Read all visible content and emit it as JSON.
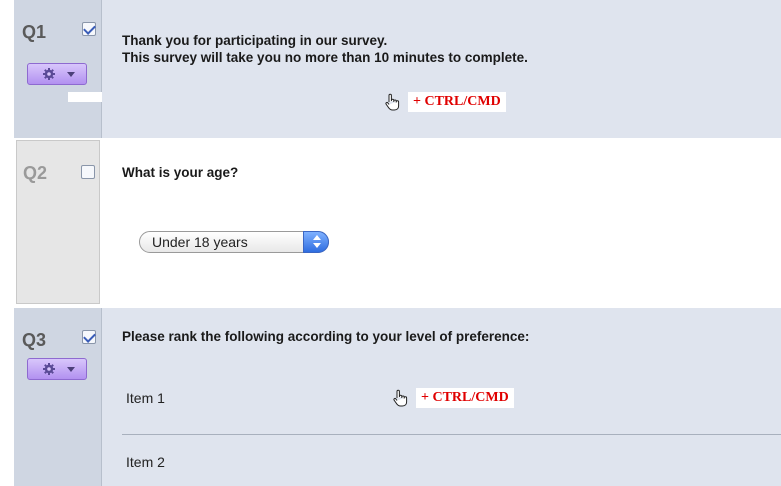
{
  "questions": [
    {
      "number": "Q1",
      "checked": true,
      "lines": [
        "Thank you for participating in our survey.",
        "This survey will take you no more than 10 minutes to complete."
      ],
      "hint": "+ CTRL/CMD"
    },
    {
      "number": "Q2",
      "checked": false,
      "text": "What is your age?",
      "select_value": "Under 18 years"
    },
    {
      "number": "Q3",
      "checked": true,
      "text": "Please rank the following according to your level of preference:",
      "items": [
        "Item 1",
        "Item 2"
      ],
      "hint": "+ CTRL/CMD"
    }
  ],
  "icons": {
    "gear": "gear-icon",
    "dropdown": "chevron-down-icon",
    "hand": "hand-pointer-icon"
  },
  "colors": {
    "selected_bg": "#dfe4ee",
    "gutter_bg": "#cfd6e2",
    "gear_button": "#b291f0",
    "hint_text": "#e00000",
    "select_arrows": "#2f6de0"
  }
}
